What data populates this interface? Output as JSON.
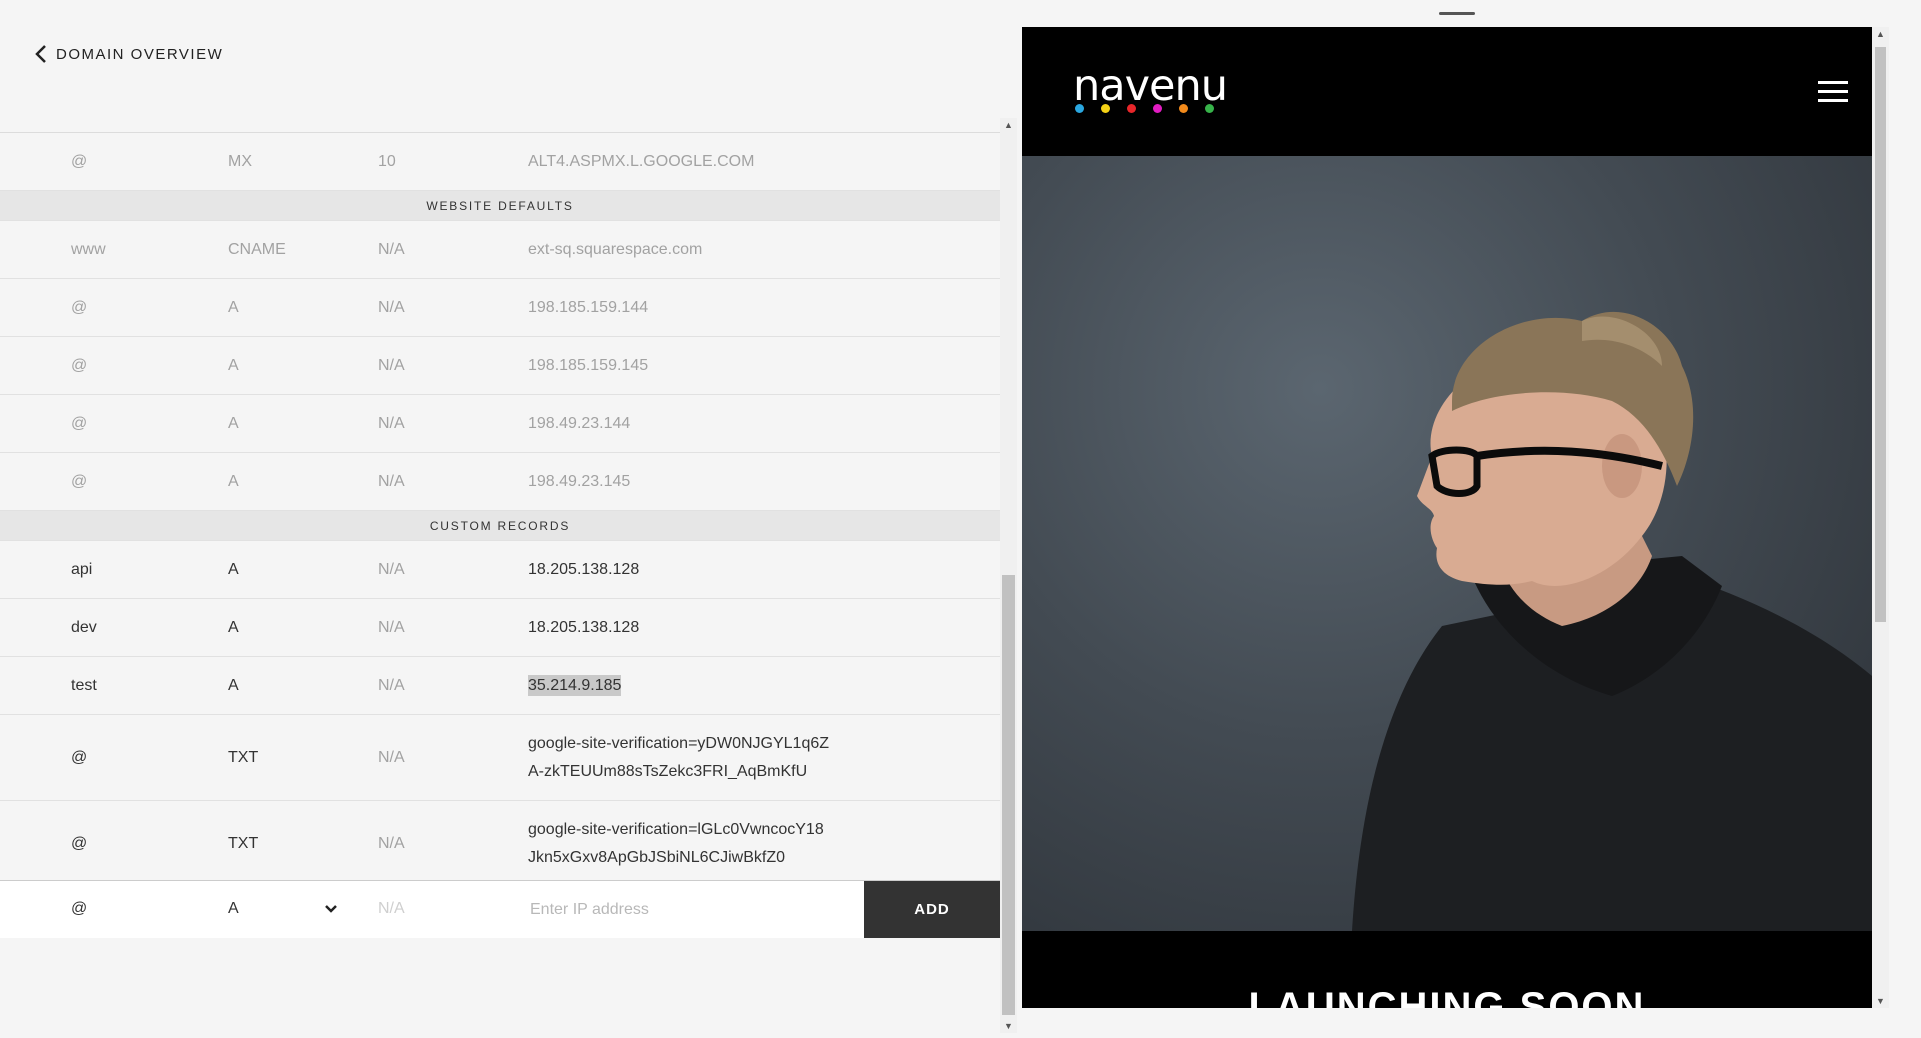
{
  "back_link": {
    "label": "DOMAIN OVERVIEW"
  },
  "records": {
    "top_row": {
      "host": "@",
      "type": "MX",
      "priority": "10",
      "data": "ALT4.ASPMX.L.GOOGLE.COM"
    },
    "website_defaults": {
      "title": "WEBSITE DEFAULTS",
      "rows": [
        {
          "host": "www",
          "type": "CNAME",
          "priority": "N/A",
          "data": "ext-sq.squarespace.com"
        },
        {
          "host": "@",
          "type": "A",
          "priority": "N/A",
          "data": "198.185.159.144"
        },
        {
          "host": "@",
          "type": "A",
          "priority": "N/A",
          "data": "198.185.159.145"
        },
        {
          "host": "@",
          "type": "A",
          "priority": "N/A",
          "data": "198.49.23.144"
        },
        {
          "host": "@",
          "type": "A",
          "priority": "N/A",
          "data": "198.49.23.145"
        }
      ]
    },
    "custom_records": {
      "title": "CUSTOM RECORDS",
      "rows": [
        {
          "host": "api",
          "type": "A",
          "priority": "N/A",
          "data": "18.205.138.128"
        },
        {
          "host": "dev",
          "type": "A",
          "priority": "N/A",
          "data": "18.205.138.128"
        },
        {
          "host": "test",
          "type": "A",
          "priority": "N/A",
          "data": "35.214.9.185"
        },
        {
          "host": "@",
          "type": "TXT",
          "priority": "N/A",
          "data_line1": "google-site-verification=yDW0NJGYL1q6Z",
          "data_line2": "A-zkTEUUm88sTsZekc3FRI_AqBmKfU"
        },
        {
          "host": "@",
          "type": "TXT",
          "priority": "N/A",
          "data_line1": "google-site-verification=lGLc0VwncocY18",
          "data_line2": "Jkn5xGxv8ApGbJSbiNL6CJiwBkfZ0"
        }
      ]
    }
  },
  "add_form": {
    "host": "@",
    "type_selected": "A",
    "priority": "N/A",
    "ip_placeholder": "Enter IP address",
    "add_label": "ADD"
  },
  "preview": {
    "logo_text": "navenu",
    "logo_dot_colors": [
      "#2aa7e0",
      "#f5d215",
      "#e8262a",
      "#e21cc2",
      "#f28a1b",
      "#37b34a"
    ],
    "launch_text": "LAUNCHING SOON"
  }
}
